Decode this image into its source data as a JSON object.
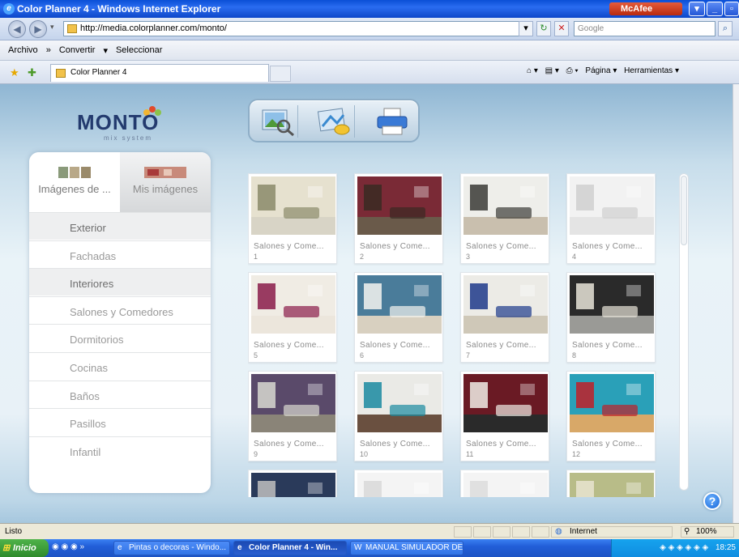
{
  "window": {
    "title": "Color Planner 4 - Windows Internet Explorer",
    "mcafee_label": "McAfee"
  },
  "address_bar": {
    "url": "http://media.colorplanner.com/monto/",
    "search_placeholder": "Google"
  },
  "menu_bar": {
    "items": [
      "Archivo",
      "»",
      "Convertir",
      "▾",
      "Seleccionar"
    ]
  },
  "tab_bar": {
    "tab_title": "Color Planner 4",
    "commands": {
      "page_label": "Página",
      "tools_label": "Herramientas"
    }
  },
  "app": {
    "logo_text": "MONTO",
    "logo_subtext": "mix system",
    "toolbar_icons": [
      "search-image-icon",
      "paint-bucket-icon",
      "printer-icon"
    ],
    "panel_tabs": [
      {
        "label": "Imágenes de ...",
        "active": true
      },
      {
        "label": "Mis imágenes",
        "active": false
      }
    ],
    "categories": [
      {
        "label": "Exterior",
        "header": true
      },
      {
        "label": "Fachadas",
        "header": false
      },
      {
        "label": "Interiores",
        "header": true
      },
      {
        "label": "Salones y Comedores",
        "header": false
      },
      {
        "label": "Dormitorios",
        "header": false
      },
      {
        "label": "Cocinas",
        "header": false
      },
      {
        "label": "Baños",
        "header": false
      },
      {
        "label": "Pasillos",
        "header": false
      },
      {
        "label": "Infantil",
        "header": false
      }
    ],
    "images": [
      {
        "caption": "Salones y Come...",
        "number": "1",
        "wall": "#e6e1cf",
        "accent": "#8a8a6a",
        "floor": "#d8d4c6"
      },
      {
        "caption": "Salones y Come...",
        "number": "2",
        "wall": "#7a2a36",
        "accent": "#3a2a22",
        "floor": "#6a5a4a"
      },
      {
        "caption": "Salones y Come...",
        "number": "3",
        "wall": "#eeeeea",
        "accent": "#3a3a36",
        "floor": "#c9bfae"
      },
      {
        "caption": "Salones y Come...",
        "number": "4",
        "wall": "#f2f2f2",
        "accent": "#d0d0d0",
        "floor": "#e4e4e4"
      },
      {
        "caption": "Salones y Come...",
        "number": "5",
        "wall": "#f0ece4",
        "accent": "#8a1c4a",
        "floor": "#ece6dc"
      },
      {
        "caption": "Salones y Come...",
        "number": "6",
        "wall": "#4a7c9a",
        "accent": "#f4f4f0",
        "floor": "#d8d0c0"
      },
      {
        "caption": "Salones y Come...",
        "number": "7",
        "wall": "#ecebe6",
        "accent": "#1e3a8a",
        "floor": "#cfc8b8"
      },
      {
        "caption": "Salones y Come...",
        "number": "8",
        "wall": "#2a2a2a",
        "accent": "#e8e4d8",
        "floor": "#9a9a96"
      },
      {
        "caption": "Salones y Come...",
        "number": "9",
        "wall": "#5a4a6a",
        "accent": "#d8d8d0",
        "floor": "#8a8478"
      },
      {
        "caption": "Salones y Come...",
        "number": "10",
        "wall": "#eaeae6",
        "accent": "#1a8aa0",
        "floor": "#6a5040"
      },
      {
        "caption": "Salones y Come...",
        "number": "11",
        "wall": "#6a1a24",
        "accent": "#f0ede6",
        "floor": "#2a2a2a"
      },
      {
        "caption": "Salones y Come...",
        "number": "12",
        "wall": "#2aa0b8",
        "accent": "#c02028",
        "floor": "#d8a868"
      },
      {
        "caption": "",
        "number": "",
        "wall": "#2a3a5a",
        "accent": "#c0c0c0",
        "floor": "#8a8a8a"
      },
      {
        "caption": "",
        "number": "",
        "wall": "#f4f4f4",
        "accent": "#d8d8d8",
        "floor": "#e8e8e8"
      },
      {
        "caption": "",
        "number": "",
        "wall": "#f4f4f4",
        "accent": "#dcdcdc",
        "floor": "#ececec"
      },
      {
        "caption": "",
        "number": "",
        "wall": "#b8bc88",
        "accent": "#e8e4d0",
        "floor": "#d8d4c0"
      }
    ]
  },
  "status_bar": {
    "status": "Listo",
    "zone": "Internet",
    "zoom": "100%"
  },
  "taskbar": {
    "start_label": "Inicio",
    "tasks": [
      {
        "label": "Pintas o decoras - Windo...",
        "active": false
      },
      {
        "label": "Color Planner 4 - Win...",
        "active": true
      },
      {
        "label": "MANUAL SIMULADOR DE...",
        "active": false
      }
    ],
    "clock": "18:25"
  }
}
